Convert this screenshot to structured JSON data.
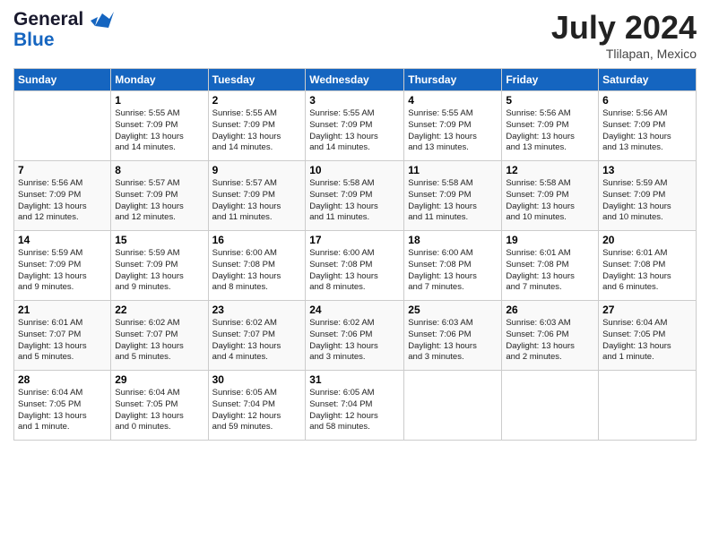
{
  "header": {
    "logo_line1": "General",
    "logo_line2": "Blue",
    "month_year": "July 2024",
    "location": "Tlilapan, Mexico"
  },
  "days_of_week": [
    "Sunday",
    "Monday",
    "Tuesday",
    "Wednesday",
    "Thursday",
    "Friday",
    "Saturday"
  ],
  "weeks": [
    [
      {
        "day": "",
        "info": ""
      },
      {
        "day": "1",
        "info": "Sunrise: 5:55 AM\nSunset: 7:09 PM\nDaylight: 13 hours\nand 14 minutes."
      },
      {
        "day": "2",
        "info": "Sunrise: 5:55 AM\nSunset: 7:09 PM\nDaylight: 13 hours\nand 14 minutes."
      },
      {
        "day": "3",
        "info": "Sunrise: 5:55 AM\nSunset: 7:09 PM\nDaylight: 13 hours\nand 14 minutes."
      },
      {
        "day": "4",
        "info": "Sunrise: 5:55 AM\nSunset: 7:09 PM\nDaylight: 13 hours\nand 13 minutes."
      },
      {
        "day": "5",
        "info": "Sunrise: 5:56 AM\nSunset: 7:09 PM\nDaylight: 13 hours\nand 13 minutes."
      },
      {
        "day": "6",
        "info": "Sunrise: 5:56 AM\nSunset: 7:09 PM\nDaylight: 13 hours\nand 13 minutes."
      }
    ],
    [
      {
        "day": "7",
        "info": "Sunrise: 5:56 AM\nSunset: 7:09 PM\nDaylight: 13 hours\nand 12 minutes."
      },
      {
        "day": "8",
        "info": "Sunrise: 5:57 AM\nSunset: 7:09 PM\nDaylight: 13 hours\nand 12 minutes."
      },
      {
        "day": "9",
        "info": "Sunrise: 5:57 AM\nSunset: 7:09 PM\nDaylight: 13 hours\nand 11 minutes."
      },
      {
        "day": "10",
        "info": "Sunrise: 5:58 AM\nSunset: 7:09 PM\nDaylight: 13 hours\nand 11 minutes."
      },
      {
        "day": "11",
        "info": "Sunrise: 5:58 AM\nSunset: 7:09 PM\nDaylight: 13 hours\nand 11 minutes."
      },
      {
        "day": "12",
        "info": "Sunrise: 5:58 AM\nSunset: 7:09 PM\nDaylight: 13 hours\nand 10 minutes."
      },
      {
        "day": "13",
        "info": "Sunrise: 5:59 AM\nSunset: 7:09 PM\nDaylight: 13 hours\nand 10 minutes."
      }
    ],
    [
      {
        "day": "14",
        "info": "Sunrise: 5:59 AM\nSunset: 7:09 PM\nDaylight: 13 hours\nand 9 minutes."
      },
      {
        "day": "15",
        "info": "Sunrise: 5:59 AM\nSunset: 7:09 PM\nDaylight: 13 hours\nand 9 minutes."
      },
      {
        "day": "16",
        "info": "Sunrise: 6:00 AM\nSunset: 7:08 PM\nDaylight: 13 hours\nand 8 minutes."
      },
      {
        "day": "17",
        "info": "Sunrise: 6:00 AM\nSunset: 7:08 PM\nDaylight: 13 hours\nand 8 minutes."
      },
      {
        "day": "18",
        "info": "Sunrise: 6:00 AM\nSunset: 7:08 PM\nDaylight: 13 hours\nand 7 minutes."
      },
      {
        "day": "19",
        "info": "Sunrise: 6:01 AM\nSunset: 7:08 PM\nDaylight: 13 hours\nand 7 minutes."
      },
      {
        "day": "20",
        "info": "Sunrise: 6:01 AM\nSunset: 7:08 PM\nDaylight: 13 hours\nand 6 minutes."
      }
    ],
    [
      {
        "day": "21",
        "info": "Sunrise: 6:01 AM\nSunset: 7:07 PM\nDaylight: 13 hours\nand 5 minutes."
      },
      {
        "day": "22",
        "info": "Sunrise: 6:02 AM\nSunset: 7:07 PM\nDaylight: 13 hours\nand 5 minutes."
      },
      {
        "day": "23",
        "info": "Sunrise: 6:02 AM\nSunset: 7:07 PM\nDaylight: 13 hours\nand 4 minutes."
      },
      {
        "day": "24",
        "info": "Sunrise: 6:02 AM\nSunset: 7:06 PM\nDaylight: 13 hours\nand 3 minutes."
      },
      {
        "day": "25",
        "info": "Sunrise: 6:03 AM\nSunset: 7:06 PM\nDaylight: 13 hours\nand 3 minutes."
      },
      {
        "day": "26",
        "info": "Sunrise: 6:03 AM\nSunset: 7:06 PM\nDaylight: 13 hours\nand 2 minutes."
      },
      {
        "day": "27",
        "info": "Sunrise: 6:04 AM\nSunset: 7:05 PM\nDaylight: 13 hours\nand 1 minute."
      }
    ],
    [
      {
        "day": "28",
        "info": "Sunrise: 6:04 AM\nSunset: 7:05 PM\nDaylight: 13 hours\nand 1 minute."
      },
      {
        "day": "29",
        "info": "Sunrise: 6:04 AM\nSunset: 7:05 PM\nDaylight: 13 hours\nand 0 minutes."
      },
      {
        "day": "30",
        "info": "Sunrise: 6:05 AM\nSunset: 7:04 PM\nDaylight: 12 hours\nand 59 minutes."
      },
      {
        "day": "31",
        "info": "Sunrise: 6:05 AM\nSunset: 7:04 PM\nDaylight: 12 hours\nand 58 minutes."
      },
      {
        "day": "",
        "info": ""
      },
      {
        "day": "",
        "info": ""
      },
      {
        "day": "",
        "info": ""
      }
    ]
  ]
}
